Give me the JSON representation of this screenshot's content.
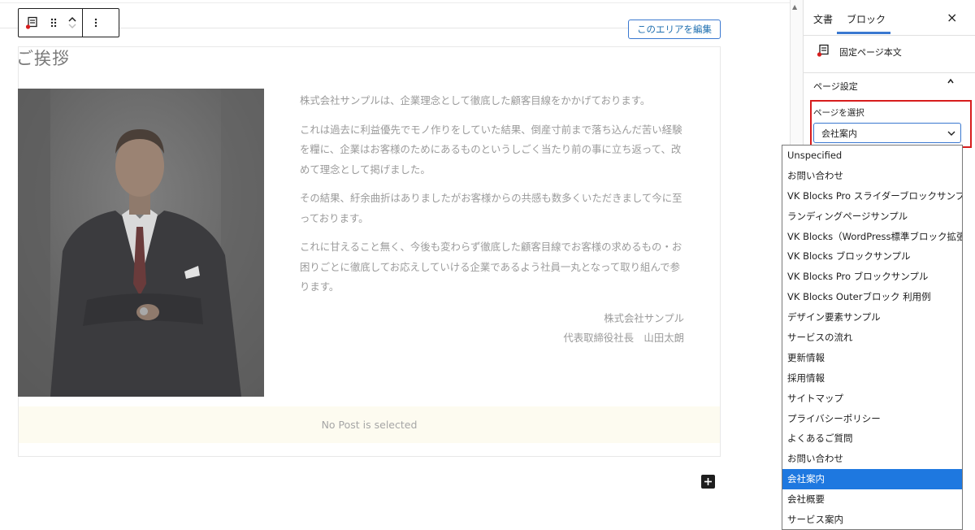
{
  "toolbar": {
    "block_icon": "page-content-block-icon",
    "drag_icon": "drag-handle-icon",
    "move_up_icon": "chevron-up-icon",
    "move_down_icon": "chevron-down-icon",
    "more_icon": "more-vertical-icon",
    "more_label": "⋮"
  },
  "editor": {
    "edit_area_button": "このエリアを編集",
    "heading": "ご挨拶",
    "paragraphs": [
      "株式会社サンプルは、企業理念として徹底した顧客目線をかかげております。",
      "これは過去に利益優先でモノ作りをしていた結果、倒産寸前まで落ち込んだ苦い経験を糧に、企業はお客様のためにあるものというしごく当たり前の事に立ち返って、改めて理念として掲げました。",
      "その結果、紆余曲折はありましたがお客様からの共感も数多くいただきまして今に至っております。",
      "これに甘えること無く、今後も変わらず徹底した顧客目線でお客様の求めるもの・お困りごとに徹底してお応えしていける企業であるよう社員一丸となって取り組んで参ります。"
    ],
    "signature_company": "株式会社サンプル",
    "signature_name": "代表取締役社長　山田太朗",
    "no_post_message": "No Post is selected",
    "add_block_icon": "plus-icon"
  },
  "sidebar": {
    "tab_document": "文書",
    "tab_block": "ブロック",
    "close_label": "×",
    "block_title": "固定ページ本文",
    "panel_title": "ページ設定",
    "panel_chevron": "⌃",
    "select_label": "ページを選択",
    "select_value": "会社案内",
    "select_chevron": "⌄"
  },
  "dropdown": {
    "options": [
      "Unspecified",
      "お問い合わせ",
      "VK Blocks Pro スライダーブロックサンプル",
      "ランディングページサンプル",
      "VK Blocks（WordPress標準ブロック拡張）",
      "VK Blocks ブロックサンプル",
      "VK Blocks Pro ブロックサンプル",
      "VK Blocks Outerブロック 利用例",
      "デザイン要素サンプル",
      "サービスの流れ",
      "更新情報",
      "採用情報",
      "サイトマップ",
      "プライバシーポリシー",
      "よくあるご質問",
      "お問い合わせ",
      "会社案内",
      "会社概要",
      "サービス案内"
    ],
    "selected_index": 16
  },
  "colors": {
    "accent_blue": "#3a78d0",
    "selected_bg": "#1e78e0",
    "highlight_red": "#d71d1d",
    "no_post_bg": "#fdfbf0"
  }
}
